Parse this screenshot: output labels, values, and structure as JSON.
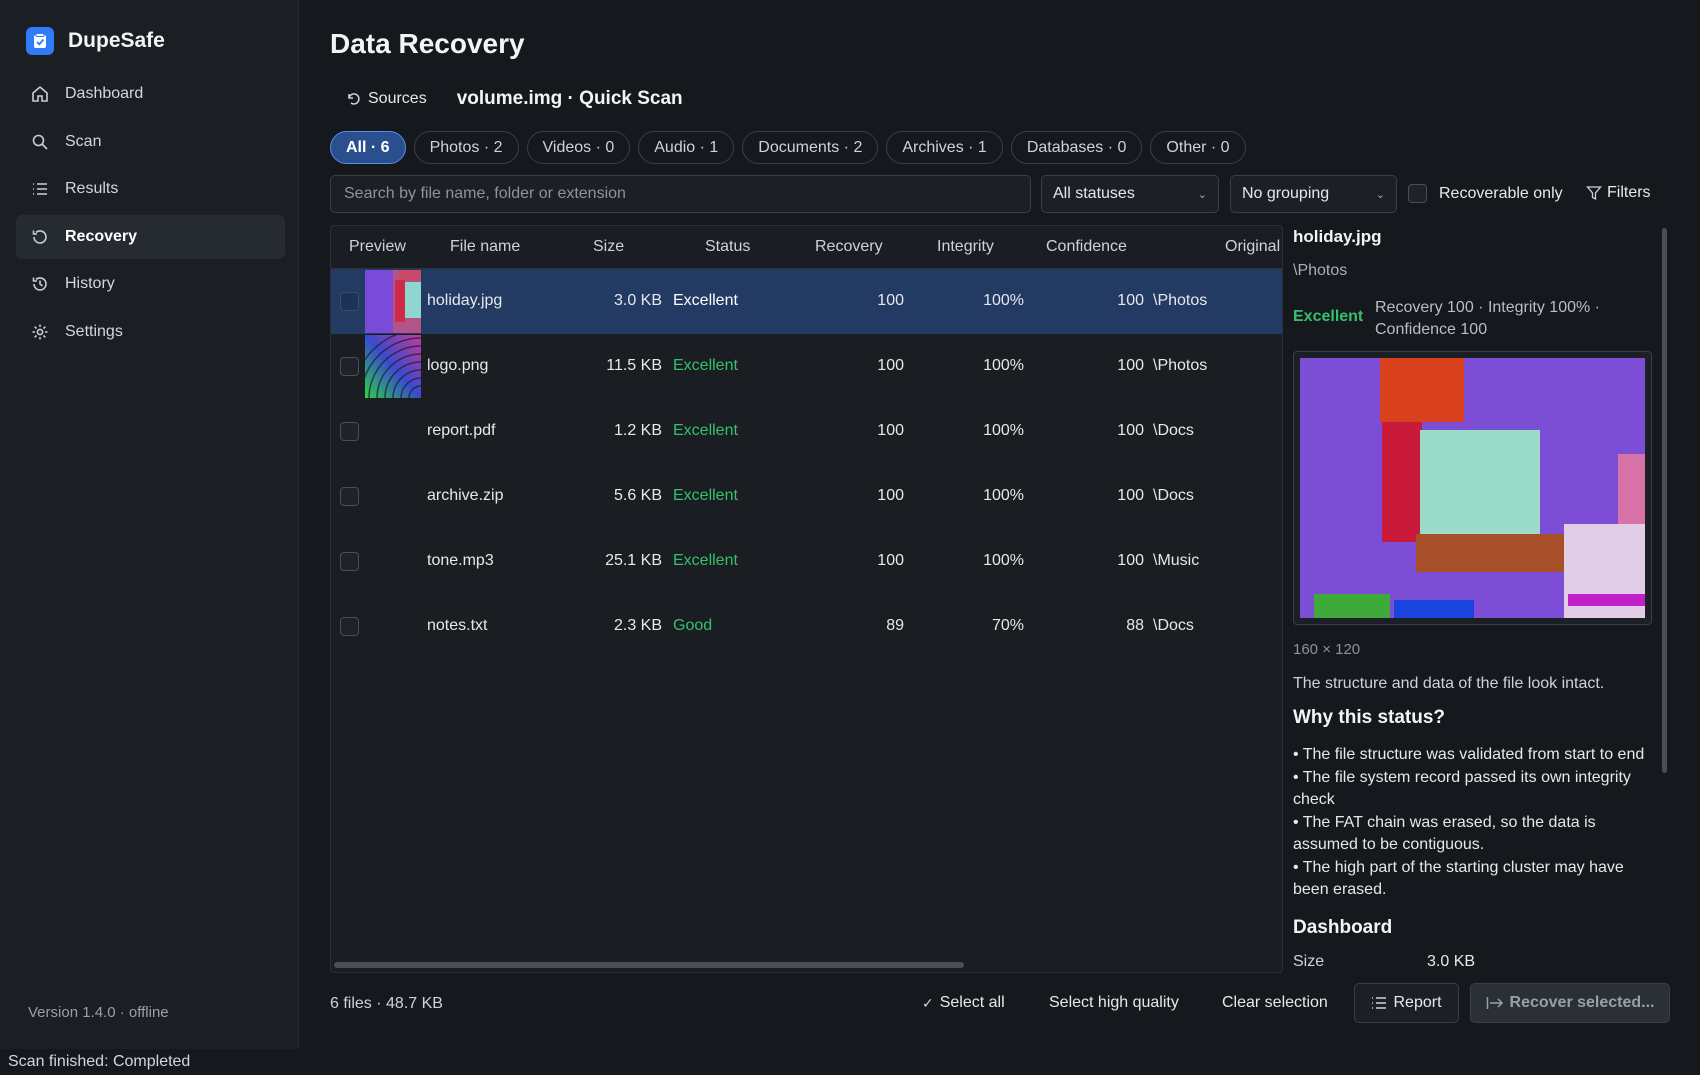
{
  "app": {
    "name": "DupeSafe",
    "version": "Version 1.4.0 · offline"
  },
  "nav": [
    {
      "label": "Dashboard",
      "icon": "home-icon",
      "active": false
    },
    {
      "label": "Scan",
      "icon": "search-icon",
      "active": false
    },
    {
      "label": "Results",
      "icon": "list-icon",
      "active": false
    },
    {
      "label": "Recovery",
      "icon": "recovery-icon",
      "active": true
    },
    {
      "label": "History",
      "icon": "history-icon",
      "active": false
    },
    {
      "label": "Settings",
      "icon": "gear-icon",
      "active": false
    }
  ],
  "page": {
    "title": "Data Recovery",
    "sources_label": "Sources",
    "scan_title": "volume.img · Quick Scan"
  },
  "chips": [
    "All · 6",
    "Photos · 2",
    "Videos · 0",
    "Audio · 1",
    "Documents · 2",
    "Archives · 1",
    "Databases · 0",
    "Other · 0"
  ],
  "toolbar": {
    "search_placeholder": "Search by file name, folder or extension",
    "status_select": "All statuses",
    "group_select": "No grouping",
    "recoverable_label": "Recoverable only",
    "filters_label": "Filters"
  },
  "table": {
    "headers": {
      "preview": "Preview",
      "name": "File name",
      "size": "Size",
      "status": "Status",
      "recovery": "Recovery",
      "integrity": "Integrity",
      "confidence": "Confidence",
      "original": "Original"
    },
    "rows": [
      {
        "name": "holiday.jpg",
        "size": "3.0 KB",
        "status": "Excellent",
        "recovery": "100",
        "integrity": "100%",
        "confidence": "100",
        "original": "\\Photos"
      },
      {
        "name": "logo.png",
        "size": "11.5 KB",
        "status": "Excellent",
        "recovery": "100",
        "integrity": "100%",
        "confidence": "100",
        "original": "\\Photos"
      },
      {
        "name": "report.pdf",
        "size": "1.2 KB",
        "status": "Excellent",
        "recovery": "100",
        "integrity": "100%",
        "confidence": "100",
        "original": "\\Docs"
      },
      {
        "name": "archive.zip",
        "size": "5.6 KB",
        "status": "Excellent",
        "recovery": "100",
        "integrity": "100%",
        "confidence": "100",
        "original": "\\Docs"
      },
      {
        "name": "tone.mp3",
        "size": "25.1 KB",
        "status": "Excellent",
        "recovery": "100",
        "integrity": "100%",
        "confidence": "100",
        "original": "\\Music"
      },
      {
        "name": "notes.txt",
        "size": "2.3 KB",
        "status": "Good",
        "recovery": "89",
        "integrity": "70%",
        "confidence": "88",
        "original": "\\Docs"
      }
    ]
  },
  "detail": {
    "title": "holiday.jpg",
    "path": "\\Photos",
    "status": "Excellent",
    "metrics": "Recovery 100 · Integrity 100% · Confidence 100",
    "dims": "160 × 120",
    "summary": "The structure and data of the file look intact.",
    "why_heading": "Why this status?",
    "reasons": [
      "• The file structure was validated from start to end",
      "• The file system record passed its own integrity check",
      "• The FAT chain was erased, so the data is assumed to be contiguous.",
      "• The high part of the starting cluster may have been erased."
    ],
    "dashboard_heading": "Dashboard",
    "size_label": "Size",
    "size_value": "3.0 KB"
  },
  "footer": {
    "count": "6 files · 48.7 KB",
    "select_all": "Select all",
    "select_high": "Select high quality",
    "clear": "Clear selection",
    "report": "Report",
    "recover": "Recover selected..."
  },
  "status_bar": "Scan finished: Completed",
  "colors": {
    "accent": "#2f7cf6",
    "status_good": "#35c06d",
    "selected_row": "#233a62"
  }
}
